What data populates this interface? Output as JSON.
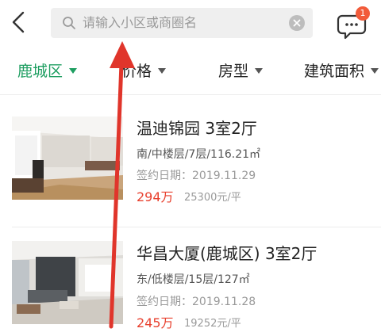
{
  "search": {
    "placeholder": "请输入小区或商圈名"
  },
  "messages": {
    "badge_count": "1"
  },
  "filters": [
    {
      "label": "鹿城区",
      "active": true
    },
    {
      "label": "价格",
      "active": false
    },
    {
      "label": "房型",
      "active": false
    },
    {
      "label": "建筑面积",
      "active": false
    }
  ],
  "listings": [
    {
      "title": "温迪锦园 3室2厅",
      "meta": "南/中楼层/7层/116.21㎡",
      "signed_date": "签约日期：2019.11.29",
      "price": "294万",
      "unit_price": "25300元/平"
    },
    {
      "title": "华昌大厦(鹿城区) 3室2厅",
      "meta": "东/低楼层/15层/127㎡",
      "signed_date": "签约日期：2019.11.28",
      "price": "245万",
      "unit_price": "19252元/平"
    }
  ],
  "colors": {
    "accent_green": "#1e9e61",
    "price_red": "#e8402e",
    "annotation_red": "#e0352b"
  }
}
